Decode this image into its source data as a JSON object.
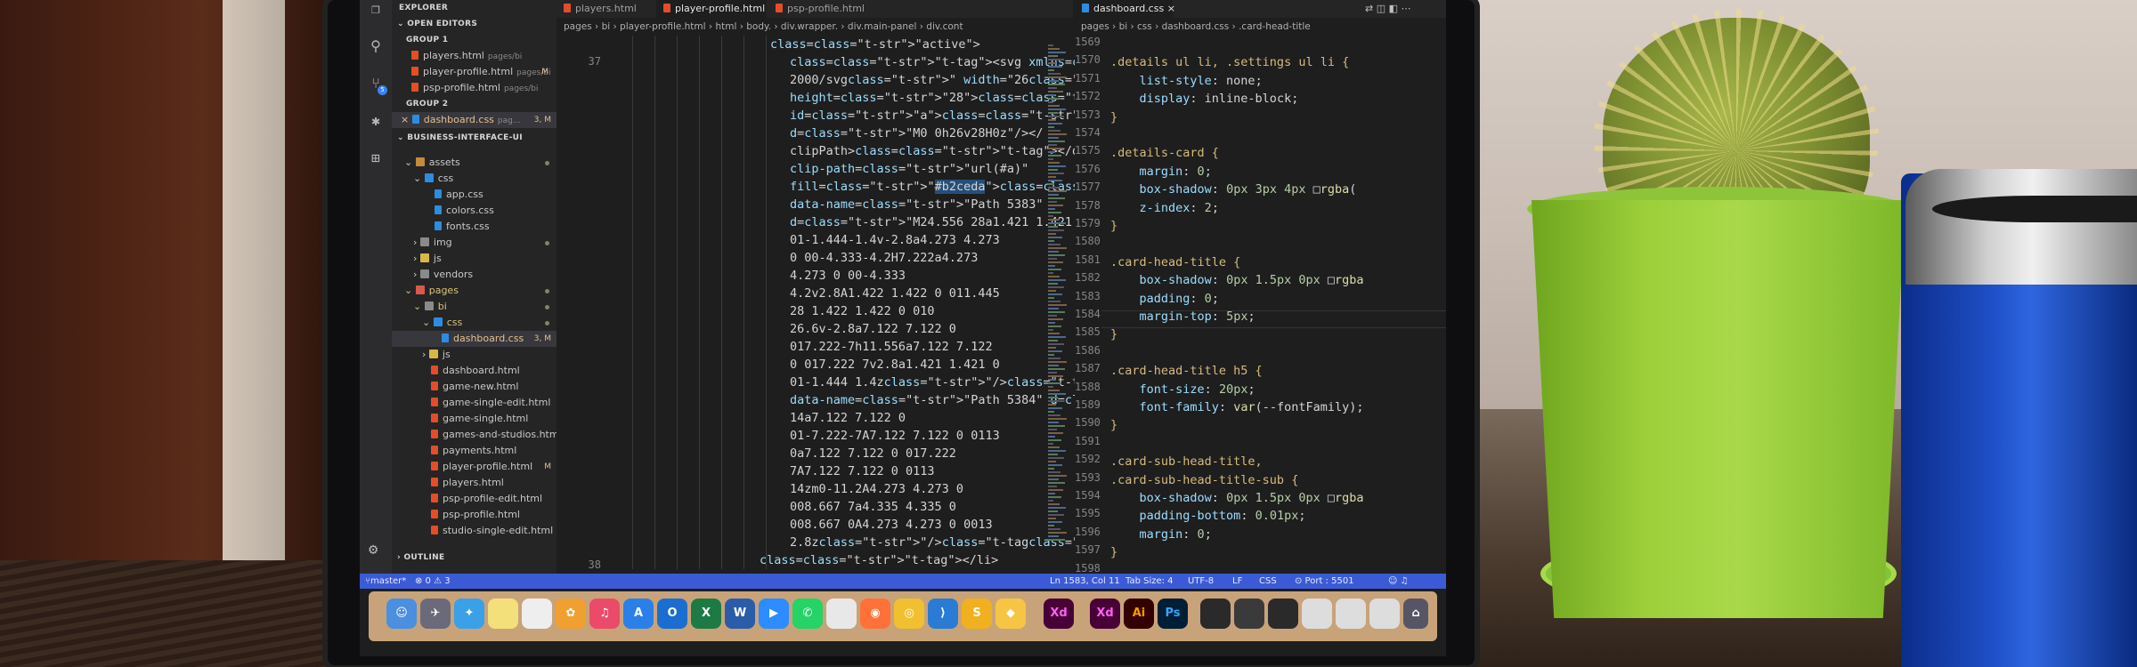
{
  "explorer": {
    "title": "EXPLORER",
    "open_editors": "OPEN EDITORS",
    "group1": "GROUP 1",
    "group2": "GROUP 2",
    "open_files_g1": [
      {
        "name": "players.html",
        "path": "pages/bi",
        "status": ""
      },
      {
        "name": "player-profile.html",
        "path": "pages/bi",
        "status": "M"
      },
      {
        "name": "psp-profile.html",
        "path": "pages/bi",
        "status": ""
      }
    ],
    "open_files_g2": [
      {
        "name": "dashboard.css",
        "path": "pag...",
        "status": "3, M"
      }
    ],
    "project": "BUSINESS-INTERFACE-UI",
    "tree": {
      "assets": "assets",
      "css": "css",
      "app": "app.css",
      "colors": "colors.css",
      "fonts": "fonts.css",
      "img": "img",
      "js": "js",
      "vendors": "vendors",
      "pages": "pages",
      "bi": "bi",
      "bi_css": "css",
      "dashboard_css": "dashboard.css",
      "dashboard_css_status": "3, M",
      "bi_js": "js",
      "files": [
        "dashboard.html",
        "game-new.html",
        "game-single-edit.html",
        "game-single.html",
        "games-and-studios.html",
        "payments.html",
        "player-profile.html",
        "players.html",
        "psp-profile-edit.html",
        "psp-profile.html",
        "studio-single-edit.html"
      ],
      "player_profile_status": "M"
    },
    "outline": "OUTLINE"
  },
  "tabs": [
    {
      "label": "players.html"
    },
    {
      "label": "player-profile.html"
    },
    {
      "label": "psp-profile.html"
    }
  ],
  "breadcrumb_left": "pages › bi › player-profile.html › html › body. › div.wrapper. › div.main-panel › div.cont",
  "code_left": {
    "line_a": "37",
    "line_b": "38",
    "lines": [
      "class=\"active\">",
      "<svg xmlns=\"http://www.w3.org/",
      "2000/svg\" width=\"26\"",
      "height=\"28\"><defs><clipPath",
      "id=\"a\"><path fill=\"none\"",
      "d=\"M0 0h26v28H0z\"/></",
      "clipPath></defs><g",
      "clip-path=\"url(#a)\"",
      "fill=\"#b2ceda\"><path",
      "data-name=\"Path 5383\"",
      "d=\"M24.556 28a1.421 1.421 0",
      "01-1.444-1.4v-2.8a4.273 4.273",
      "0 00-4.333-4.2H7.222a4.273",
      "4.273 0 00-4.333",
      "4.2v2.8A1.422 1.422 0 011.445",
      "28 1.422 1.422 0 010",
      "26.6v-2.8a7.122 7.122 0",
      "017.222-7h11.556a7.122 7.122",
      "0 017.222 7v2.8a1.421 1.421 0",
      "01-1.444 1.4z\"/><path",
      "data-name=\"Path 5384\" d=\"M13",
      "14a7.122 7.122 0",
      "01-7.222-7A7.122 7.122 0 0113",
      "0a7.122 7.122 0 017.222",
      "7A7.122 7.122 0 0113",
      "14zm0-11.2A4.273 4.273 0",
      "008.667 7a4.335 4.335 0",
      "008.667 0A4.273 4.273 0 0013",
      "2.8z\"/></g></svg>",
      "</li>"
    ]
  },
  "right_tab": {
    "label": "dashboard.css"
  },
  "breadcrumb_right": "pages › bi › css › dashboard.css › .card-head-title",
  "code_right": {
    "numbers": [
      "1569",
      "1570",
      "1571",
      "1572",
      "1573",
      "1574",
      "1575",
      "1576",
      "1577",
      "1578",
      "1579",
      "1580",
      "1581",
      "1582",
      "1583",
      "1584",
      "1585",
      "1586",
      "1587",
      "1588",
      "1589",
      "1590",
      "1591",
      "1592",
      "1593",
      "1594",
      "1595",
      "1596",
      "1597",
      "1598"
    ],
    "lines": [
      "",
      ".details ul li, .settings ul li {",
      "    list-style: none;",
      "    display: inline-block;",
      "}",
      "",
      ".details-card {",
      "    margin: 0;",
      "    box-shadow: 0px 3px 4px □rgba(",
      "    z-index: 2;",
      "}",
      "",
      ".card-head-title {",
      "    box-shadow: 0px 1.5px 0px □rgba",
      "    padding: 0;",
      "    margin-top: 5px;",
      "}",
      "",
      ".card-head-title h5 {",
      "    font-size: 20px;",
      "    font-family: var(--fontFamily);",
      "}",
      "",
      ".card-sub-head-title,",
      ".card-sub-head-title-sub {",
      "    box-shadow: 0px 1.5px 0px □rgba",
      "    padding-bottom: 0.01px;",
      "    margin: 0;",
      "}",
      ""
    ]
  },
  "status": {
    "branch": "master*",
    "problems": "⊗ 0 ⚠ 3",
    "position": "Ln 1583, Col 11",
    "tab_size": "Tab Size: 4",
    "encoding": "UTF-8",
    "eol": "LF",
    "lang": "CSS",
    "port": "⊙ Port : 5501"
  },
  "dock": {
    "xd1": "Xd",
    "xd2": "Xd",
    "ai": "Ai",
    "ps": "Ps"
  },
  "colors": {
    "status_bar": "#3b5bd6",
    "editor_bg": "#1e1e1e",
    "sidebar_bg": "#252526",
    "pot_green": "#9ccf3a",
    "cup_blue": "#1f51c9"
  }
}
